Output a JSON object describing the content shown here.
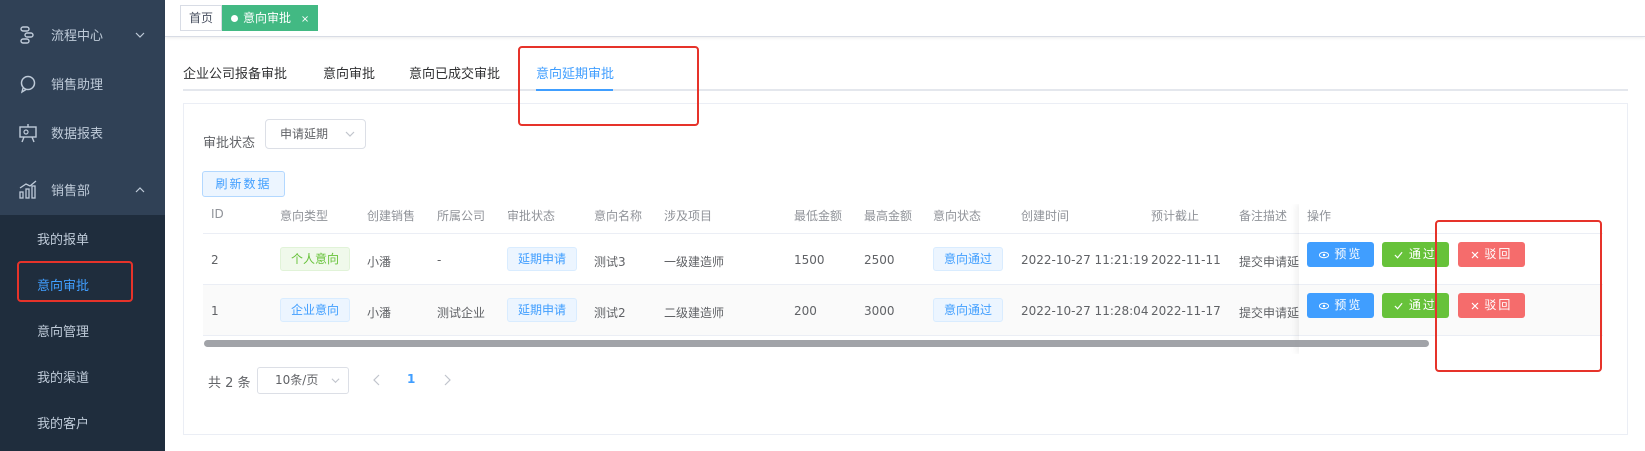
{
  "sidebar": {
    "menus": [
      {
        "label": "流程中心",
        "icon": "flow-icon",
        "arrow": "down"
      },
      {
        "label": "销售助理",
        "icon": "chat-bubble-icon",
        "arrow": ""
      },
      {
        "label": "数据报表",
        "icon": "presentation-chart-icon",
        "arrow": ""
      },
      {
        "label": "销售部",
        "icon": "bar-chart-icon",
        "arrow": "up"
      }
    ],
    "sub_items": [
      "我的报单",
      "意向审批",
      "意向管理",
      "我的渠道",
      "我的客户"
    ],
    "active_sub": "意向审批"
  },
  "tags": {
    "home": "首页",
    "current": "意向审批",
    "close": "×"
  },
  "tabs": [
    "企业公司报备审批",
    "意向审批",
    "意向已成交审批",
    "意向延期审批"
  ],
  "active_tab": "意向延期审批",
  "filter": {
    "label": "审批状态",
    "value": "申请延期"
  },
  "refresh_label": "刷新数据",
  "table": {
    "columns": [
      "ID",
      "意向类型",
      "创建销售",
      "所属公司",
      "审批状态",
      "意向名称",
      "涉及项目",
      "最低金额",
      "最高金额",
      "意向状态",
      "创建时间",
      "预计截止",
      "备注描述",
      "操作"
    ],
    "rows": [
      {
        "id": "2",
        "type": "个人意向",
        "sales": "小潘",
        "company": "-",
        "approval": "延期申请",
        "name": "测试3",
        "project": "一级建造师",
        "min": "1500",
        "max": "2500",
        "status": "意向通过",
        "created": "2022-10-27 11:21:19",
        "deadline": "2022-11-11",
        "note": "提交申请延期"
      },
      {
        "id": "1",
        "type": "企业意向",
        "sales": "小潘",
        "company": "测试企业",
        "approval": "延期申请",
        "name": "测试2",
        "project": "二级建造师",
        "min": "200",
        "max": "3000",
        "status": "意向通过",
        "created": "2022-10-27 11:28:04",
        "deadline": "2022-11-17",
        "note": "提交申请延期"
      }
    ],
    "actions": {
      "preview": "预览",
      "pass": "通过",
      "reject": "驳回"
    }
  },
  "pagination": {
    "total": "共 2 条",
    "page_size": "10条/页",
    "current_page": "1"
  },
  "colors": {
    "sidebar_bg": "#304156",
    "submenu_bg": "#1f2d3d",
    "primary": "#409eff",
    "success": "#67c23a",
    "danger": "#f56c6c",
    "tag_active": "#42b983",
    "highlight": "#e6332a"
  }
}
